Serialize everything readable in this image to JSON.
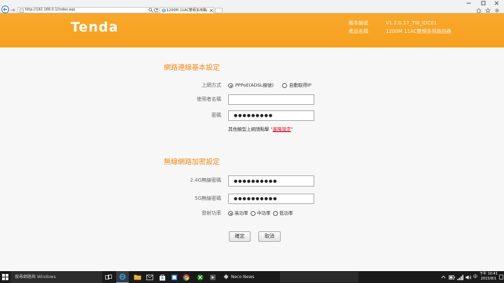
{
  "browser": {
    "address_url": "http://192.168.0.1/index.asp",
    "tab_title": "1200M 11AC雙頻多用路由...",
    "icons": [
      "back-icon",
      "forward-icon",
      "page-icon",
      "search-icon",
      "refresh-icon",
      "close-tab-icon",
      "new-tab-icon",
      "home-icon",
      "favorites-star-icon",
      "settings-gear-icon"
    ],
    "window_controls": [
      "minimize-icon",
      "maximize-icon",
      "close-icon"
    ]
  },
  "header": {
    "logo_text": "Tenda",
    "version_label": "版本編號",
    "version_value": "V1.2.0.17_TW_IDC01",
    "product_label": "產品名稱",
    "product_value": "1200M 11AC雙頻多用路由器"
  },
  "wan": {
    "title": "網路連線基本設定",
    "mode_label": "上網方式",
    "mode_options": [
      {
        "label": "PPPoE(ADSL撥號)",
        "checked": true
      },
      {
        "label": "自動取得IP",
        "checked": false
      }
    ],
    "username_label": "使用者名稱",
    "username_value": "",
    "password_label": "密碼",
    "password_display": "●●●●●●●●●",
    "hint_prefix": "其他類型上網請點擊",
    "quote_open": "\"",
    "advanced_link": "進階設定",
    "quote_close": "\""
  },
  "wireless": {
    "title": "無線網路加密設定",
    "pwd24_label": "2.4G無線密碼",
    "pwd24_display": "●●●●●●●●●●",
    "pwd5_label": "5G無線密碼",
    "pwd5_display": "●●●●●●●●●●",
    "power_label": "發射功率",
    "power_options": [
      {
        "label": "高功率",
        "checked": true
      },
      {
        "label": "中功率",
        "checked": false
      },
      {
        "label": "低功率",
        "checked": false
      }
    ]
  },
  "actions": {
    "confirm_label": "確定",
    "cancel_label": "取消"
  },
  "taskbar": {
    "search_placeholder": "搜尋網路與 Windows",
    "news_app_label": "Neco News",
    "ime": "中",
    "time": "下午 10:41",
    "date": "2015/8/1",
    "icons": [
      "windows-logo-icon",
      "task-view-icon",
      "internet-explorer-icon",
      "file-explorer-icon",
      "mail-icon",
      "store-icon",
      "app-icon",
      "chrome-icon",
      "xbox-icon",
      "media-icon",
      "news-icon",
      "show-hidden-icons-icon",
      "battery-icon",
      "network-icon",
      "volume-icon",
      "notification-icon"
    ]
  },
  "theme": {
    "header_orange": "#f6a01f",
    "section_title_orange": "#f08a1c",
    "link_red": "#d4001c",
    "taskbar_bg": "#1a1a1a"
  }
}
